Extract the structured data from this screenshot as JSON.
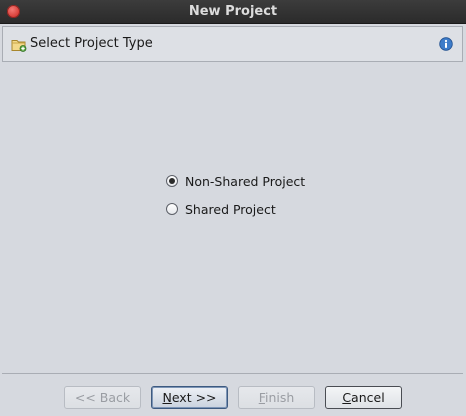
{
  "window": {
    "title": "New Project"
  },
  "header": {
    "label": "Select Project Type",
    "icon": "folder-new-icon",
    "info_icon": "info-icon"
  },
  "options": {
    "non_shared": {
      "label": "Non-Shared Project",
      "selected": true
    },
    "shared": {
      "label": "Shared Project",
      "selected": false
    }
  },
  "buttons": {
    "back": {
      "label": "<< Back",
      "enabled": false
    },
    "next": {
      "prefix": "",
      "mnemonic": "N",
      "rest": "ext >>",
      "enabled": true
    },
    "finish": {
      "mnemonic": "F",
      "rest": "inish",
      "enabled": false
    },
    "cancel": {
      "mnemonic": "C",
      "rest": "ancel",
      "enabled": true
    }
  },
  "colors": {
    "close_button": "#d9413b",
    "title_bar": "#2f2f2f",
    "panel_bg": "#d6d9df",
    "info_icon": "#3d7cc9"
  }
}
